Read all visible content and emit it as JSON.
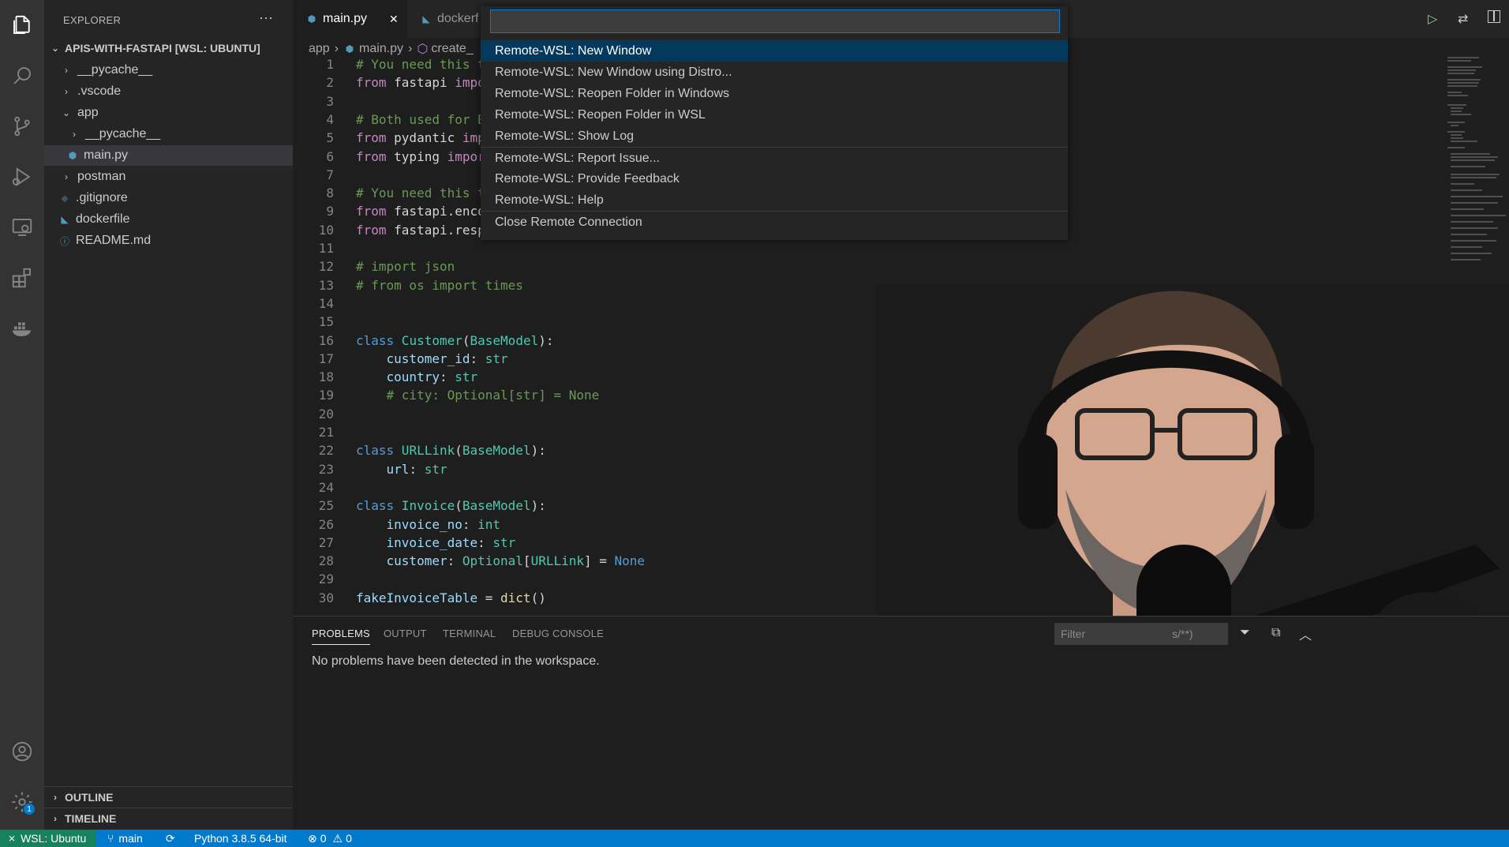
{
  "sidebar": {
    "title": "EXPLORER",
    "more": "···",
    "root": "APIS-WITH-FASTAPI [WSL: UBUNTU]",
    "items": [
      {
        "label": "__pycache__"
      },
      {
        "label": ".vscode"
      },
      {
        "label": "app"
      },
      {
        "label": "__pycache__"
      },
      {
        "label": "main.py"
      },
      {
        "label": "postman"
      },
      {
        "label": ".gitignore"
      },
      {
        "label": "dockerfile"
      },
      {
        "label": "README.md"
      }
    ],
    "outline": "OUTLINE",
    "timeline": "TIMELINE"
  },
  "tabs": [
    {
      "label": "main.py",
      "close": "✕"
    },
    {
      "label": "dockerf"
    }
  ],
  "breadcrumb": {
    "part1": "app",
    "part2": "main.py",
    "part3": "create_"
  },
  "code": {
    "l1": "# You need this t",
    "l2a": "from",
    "l2b": " fastapi ",
    "l2c": "impo",
    "l4": "# Both used for B",
    "l5a": "from",
    "l5b": " pydantic ",
    "l5c": "imp",
    "l6a": "from",
    "l6b": " typing ",
    "l6c": "impor",
    "l8": "# You need this t",
    "l9a": "from",
    "l9b": " fastapi.enco",
    "l10a": "from",
    "l10b": " fastapi.resp",
    "l12": "# import json",
    "l13": "# from os import times",
    "l16a": "class",
    "l16b": " Customer",
    "l16c": "(",
    "l16d": "BaseModel",
    "l16e": "):",
    "l17a": "customer_id",
    "l17b": ": ",
    "l17c": "str",
    "l18a": "country",
    "l18b": ": ",
    "l18c": "str",
    "l19": "# city: Optional[str] = None",
    "l22a": "class",
    "l22b": " URLLink",
    "l22c": "(",
    "l22d": "BaseModel",
    "l22e": "):",
    "l23a": "url",
    "l23b": ": ",
    "l23c": "str",
    "l25a": "class",
    "l25b": " Invoice",
    "l25c": "(",
    "l25d": "BaseModel",
    "l25e": "):",
    "l26a": "invoice_no",
    "l26b": ": ",
    "l26c": "int",
    "l27a": "invoice_date",
    "l27b": ": ",
    "l27c": "str",
    "l28a": "customer",
    "l28b": ": ",
    "l28c": "Optional",
    "l28d": "[",
    "l28e": "URLLink",
    "l28f": "] = ",
    "l28g": "None",
    "l30a": "fakeInvoiceTable",
    "l30b": " = ",
    "l30c": "dict",
    "l30d": "()"
  },
  "line_numbers": [
    "1",
    "2",
    "3",
    "4",
    "5",
    "6",
    "7",
    "8",
    "9",
    "10",
    "11",
    "12",
    "13",
    "14",
    "15",
    "16",
    "17",
    "18",
    "19",
    "20",
    "21",
    "22",
    "23",
    "24",
    "25",
    "26",
    "27",
    "28",
    "29",
    "30"
  ],
  "quickpick": {
    "input_value": "",
    "items": [
      "Remote-WSL: New Window",
      "Remote-WSL: New Window using Distro...",
      "Remote-WSL: Reopen Folder in Windows",
      "Remote-WSL: Reopen Folder in WSL",
      "Remote-WSL: Show Log",
      "Remote-WSL: Report Issue...",
      "Remote-WSL: Provide Feedback",
      "Remote-WSL: Help",
      "Close Remote Connection"
    ]
  },
  "panel": {
    "tabs": [
      "PROBLEMS",
      "OUTPUT",
      "TERMINAL",
      "DEBUG CONSOLE"
    ],
    "message": "No problems have been detected in the workspace.",
    "filter_placeholder": "Filter",
    "filter_suffix": "s/**)"
  },
  "statusbar": {
    "remote": "WSL: Ubuntu",
    "branch": "main",
    "python": "Python 3.8.5 64-bit",
    "errors": "0",
    "warnings": "0"
  },
  "badges": {
    "settings": "1"
  },
  "colors": {
    "accent": "#007acc",
    "remote": "#16825d",
    "focus_item": "#04395e"
  }
}
